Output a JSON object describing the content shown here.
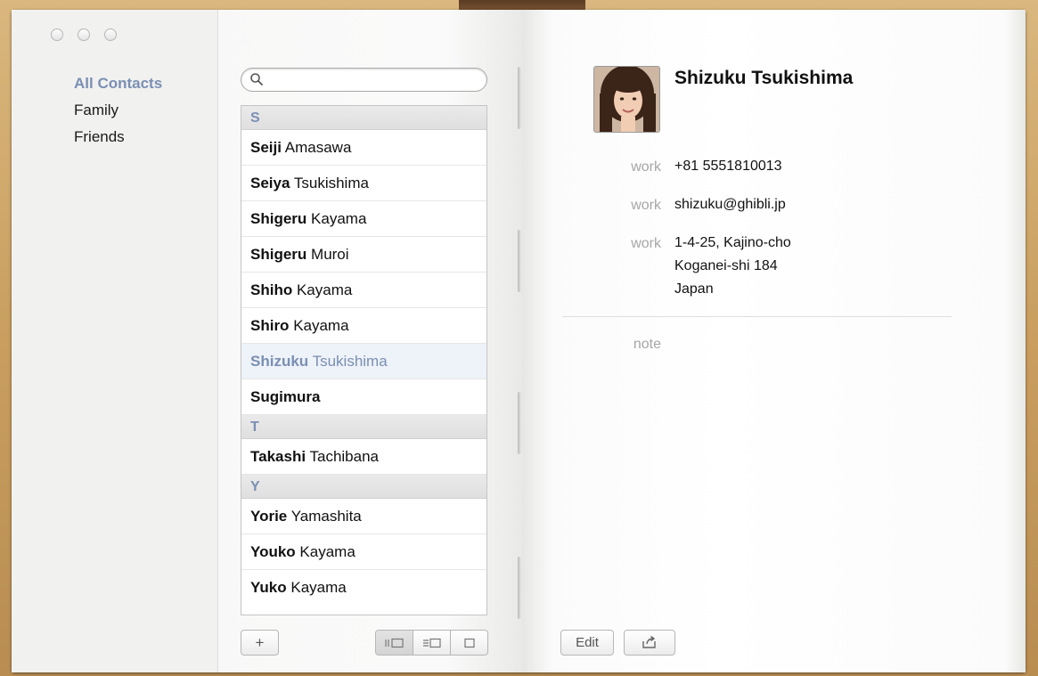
{
  "window": {
    "controls": [
      "close",
      "minimize",
      "zoom"
    ]
  },
  "sidebar": {
    "groups": [
      {
        "label": "All Contacts",
        "selected": true
      },
      {
        "label": "Family",
        "selected": false
      },
      {
        "label": "Friends",
        "selected": false
      }
    ]
  },
  "search": {
    "placeholder": "",
    "icon": "search-icon"
  },
  "contacts": {
    "sections": [
      {
        "header": "S",
        "rows": [
          {
            "first": "Seiji",
            "last": "Amasawa"
          },
          {
            "first": "Seiya",
            "last": "Tsukishima"
          },
          {
            "first": "Shigeru",
            "last": "Kayama"
          },
          {
            "first": "Shigeru",
            "last": "Muroi"
          },
          {
            "first": "Shiho",
            "last": "Kayama"
          },
          {
            "first": "Shiro",
            "last": "Kayama"
          },
          {
            "first": "Shizuku",
            "last": "Tsukishima",
            "selected": true
          },
          {
            "first": "Sugimura",
            "last": ""
          }
        ]
      },
      {
        "header": "T",
        "rows": [
          {
            "first": "Takashi",
            "last": "Tachibana"
          }
        ]
      },
      {
        "header": "Y",
        "rows": [
          {
            "first": "Yorie",
            "last": "Yamashita"
          },
          {
            "first": "Youko",
            "last": "Kayama"
          },
          {
            "first": "Yuko",
            "last": "Kayama"
          }
        ]
      }
    ]
  },
  "list_toolbar": {
    "add_label": "+",
    "view_modes": [
      "card-and-list",
      "list-and-card",
      "card-only"
    ]
  },
  "card": {
    "name": "Shizuku Tsukishima",
    "phone_label": "work",
    "phone": "+81 5551810013",
    "email_label": "work",
    "email": "shizuku@ghibli.jp",
    "address_label": "work",
    "address_lines": [
      "1-4-25, Kajino-cho",
      "Koganei-shi 184",
      "Japan"
    ],
    "note_label": "note",
    "note": ""
  },
  "card_toolbar": {
    "edit_label": "Edit",
    "share_icon": "share-icon"
  },
  "colors": {
    "accent": "#7a8fb3",
    "cover": "#c99e5f"
  }
}
